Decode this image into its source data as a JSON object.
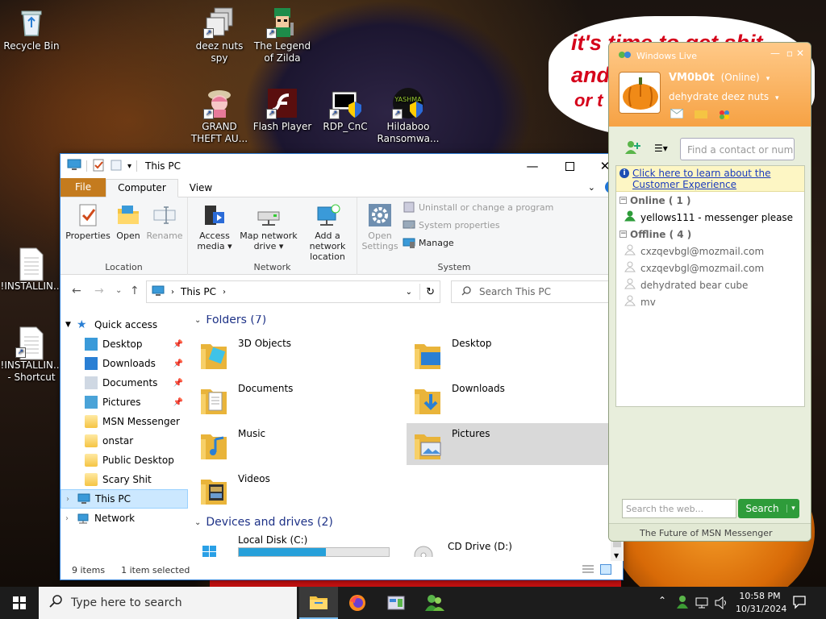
{
  "desktop": {
    "icons": [
      {
        "label": "Recycle Bin"
      },
      {
        "label": "deez nuts spy"
      },
      {
        "label": "The Legend of Zilda"
      },
      {
        "label": "GRAND THEFT AU..."
      },
      {
        "label": "Flash Player"
      },
      {
        "label": "RDP_CnC"
      },
      {
        "label": "Hildaboo Ransomwa..."
      },
      {
        "label": "!INSTALLIN..."
      },
      {
        "label": "!INSTALLIN... - Shortcut"
      }
    ],
    "wallpaper_text": [
      "it's time to get shit",
      "and",
      "or t"
    ],
    "hat_text": "YASHMA"
  },
  "explorer": {
    "title": "This PC",
    "tabs": {
      "file": "File",
      "computer": "Computer",
      "view": "View"
    },
    "help": "?",
    "ribbon": {
      "location_group": "Location",
      "properties": "Properties",
      "open": "Open",
      "rename": "Rename",
      "network_group": "Network",
      "access_media": "Access media ▾",
      "map_network_drive": "Map network drive ▾",
      "add_network_location": "Add a network location",
      "system_group": "System",
      "open_settings": "Open Settings",
      "uninstall": "Uninstall or change a program",
      "system_properties": "System properties",
      "manage": "Manage"
    },
    "address": {
      "path": "This PC",
      "search_placeholder": "Search This PC"
    },
    "nav": {
      "quick_access": "Quick access",
      "items": [
        {
          "label": "Desktop",
          "pinned": true
        },
        {
          "label": "Downloads",
          "pinned": true
        },
        {
          "label": "Documents",
          "pinned": true
        },
        {
          "label": "Pictures",
          "pinned": true
        },
        {
          "label": "MSN Messenger",
          "pinned": false
        },
        {
          "label": "onstar",
          "pinned": false
        },
        {
          "label": "Public Desktop",
          "pinned": false
        },
        {
          "label": "Scary Shit",
          "pinned": false
        }
      ],
      "this_pc": "This PC",
      "network": "Network"
    },
    "folders_header": "Folders (7)",
    "folders": [
      {
        "label": "3D Objects"
      },
      {
        "label": "Desktop"
      },
      {
        "label": "Documents"
      },
      {
        "label": "Downloads"
      },
      {
        "label": "Music"
      },
      {
        "label": "Pictures"
      },
      {
        "label": "Videos"
      }
    ],
    "drives_header": "Devices and drives (2)",
    "drives": [
      {
        "label": "Local Disk (C:)",
        "used_fraction": 0.58
      },
      {
        "label": "CD Drive (D:)"
      }
    ],
    "status": {
      "items": "9 items",
      "selected": "1 item selected"
    }
  },
  "messenger": {
    "window_title": "Windows Live",
    "username": "VM0b0t",
    "status": "(Online)",
    "personal_message": "dehydrate deez nuts",
    "search_contact_placeholder": "Find a contact or number",
    "info_link": "Click here to learn about the Customer Experience",
    "online_header": "Online ( 1 )",
    "online": [
      "yellows111 - messenger please"
    ],
    "offline_header": "Offline ( 4 )",
    "offline": [
      "cxzqevbgl@mozmail.com",
      "cxzqevbgl@mozmail.com",
      "dehydrated bear cube",
      "mv"
    ],
    "web_search_placeholder": "Search the web...",
    "search_button": "Search",
    "footer": "The Future of MSN Messenger"
  },
  "taskbar": {
    "search_placeholder": "Type here to search",
    "time": "10:58 PM",
    "date": "10/31/2024"
  },
  "colors": {
    "ribbon_file": "#c47b1e",
    "selection": "#cce8ff",
    "msn_orange": "#f6a244",
    "search_green": "#2e9c3a",
    "drive_bar": "#26a0da"
  }
}
